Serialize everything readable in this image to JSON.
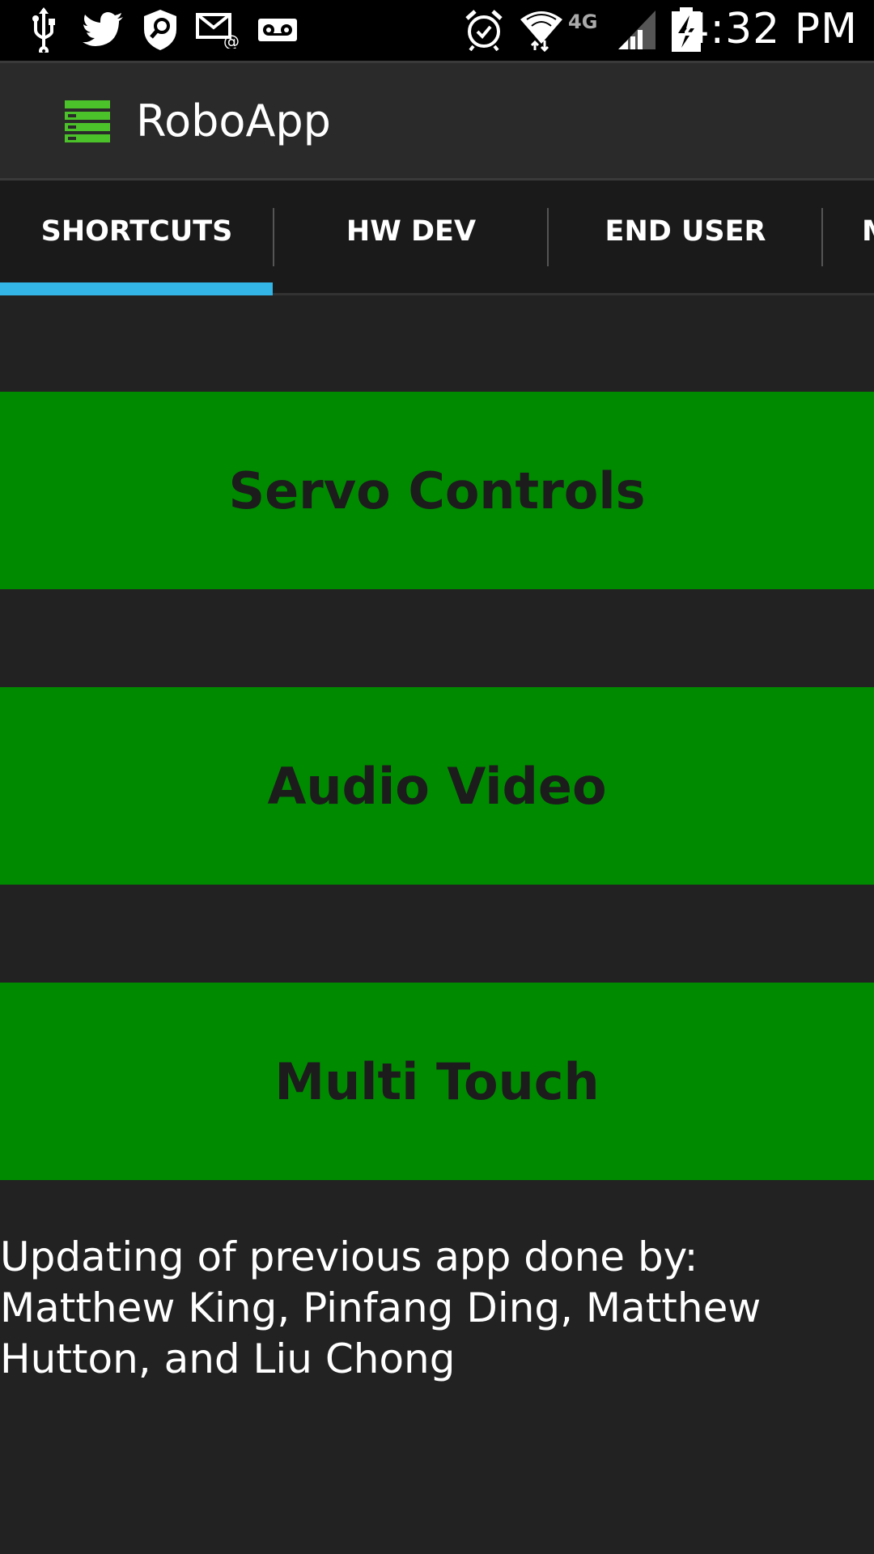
{
  "status_bar": {
    "time": "4:32 PM",
    "left_icons": [
      "usb-icon",
      "twitter-icon",
      "shield-search-icon",
      "email-at-icon",
      "voicemail-icon"
    ],
    "right_icons": [
      "alarm-icon",
      "wifi-icon",
      "lte-icon",
      "signal-icon",
      "battery-charging-icon"
    ],
    "network_label": "4G"
  },
  "action_bar": {
    "title": "RoboApp",
    "icon": "robot-app-icon",
    "icon_color": "#4cc22a"
  },
  "tabs": [
    {
      "label": "SHORTCUTS",
      "selected": true
    },
    {
      "label": "HW DEV",
      "selected": false
    },
    {
      "label": "END USER",
      "selected": false
    },
    {
      "label": "M",
      "selected": false
    }
  ],
  "colors": {
    "tab_indicator": "#33b5e5",
    "button_green": "#008a00",
    "background": "#222222"
  },
  "shortcuts": [
    {
      "label": "Servo Controls"
    },
    {
      "label": "Audio Video"
    },
    {
      "label": "Multi Touch"
    }
  ],
  "credits_text": "Updating of previous app done by: Matthew King, Pinfang Ding, Matthew Hutton, and Liu Chong"
}
